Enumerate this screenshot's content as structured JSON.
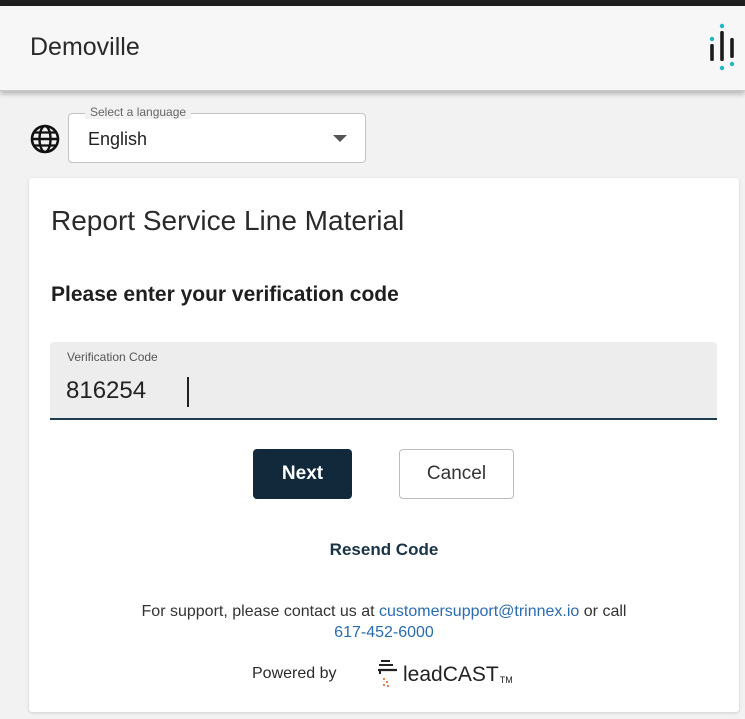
{
  "header": {
    "title": "Demoville",
    "logo": "trinnex-dots-logo"
  },
  "language": {
    "legend": "Select a language",
    "selected": "English",
    "icon": "globe-icon"
  },
  "card": {
    "title": "Report Service Line Material",
    "prompt": "Please enter your verification code",
    "verification": {
      "label": "Verification Code",
      "value": "816254"
    },
    "next_label": "Next",
    "cancel_label": "Cancel",
    "resend_label": "Resend Code",
    "support": {
      "text_before": "For support, please contact us at",
      "email": "customersupport@trinnex.io",
      "text_middle": "or call",
      "phone": "617-452-6000"
    },
    "powered": {
      "text": "Powered by",
      "brand_light": "lead",
      "brand_caps": "CAST",
      "brand_tm": "TM"
    }
  },
  "colors": {
    "primary_button": "#11293a",
    "link": "#2a6bb0",
    "field_underline": "#1d3c50",
    "logo_teal": "#22b5c4"
  }
}
